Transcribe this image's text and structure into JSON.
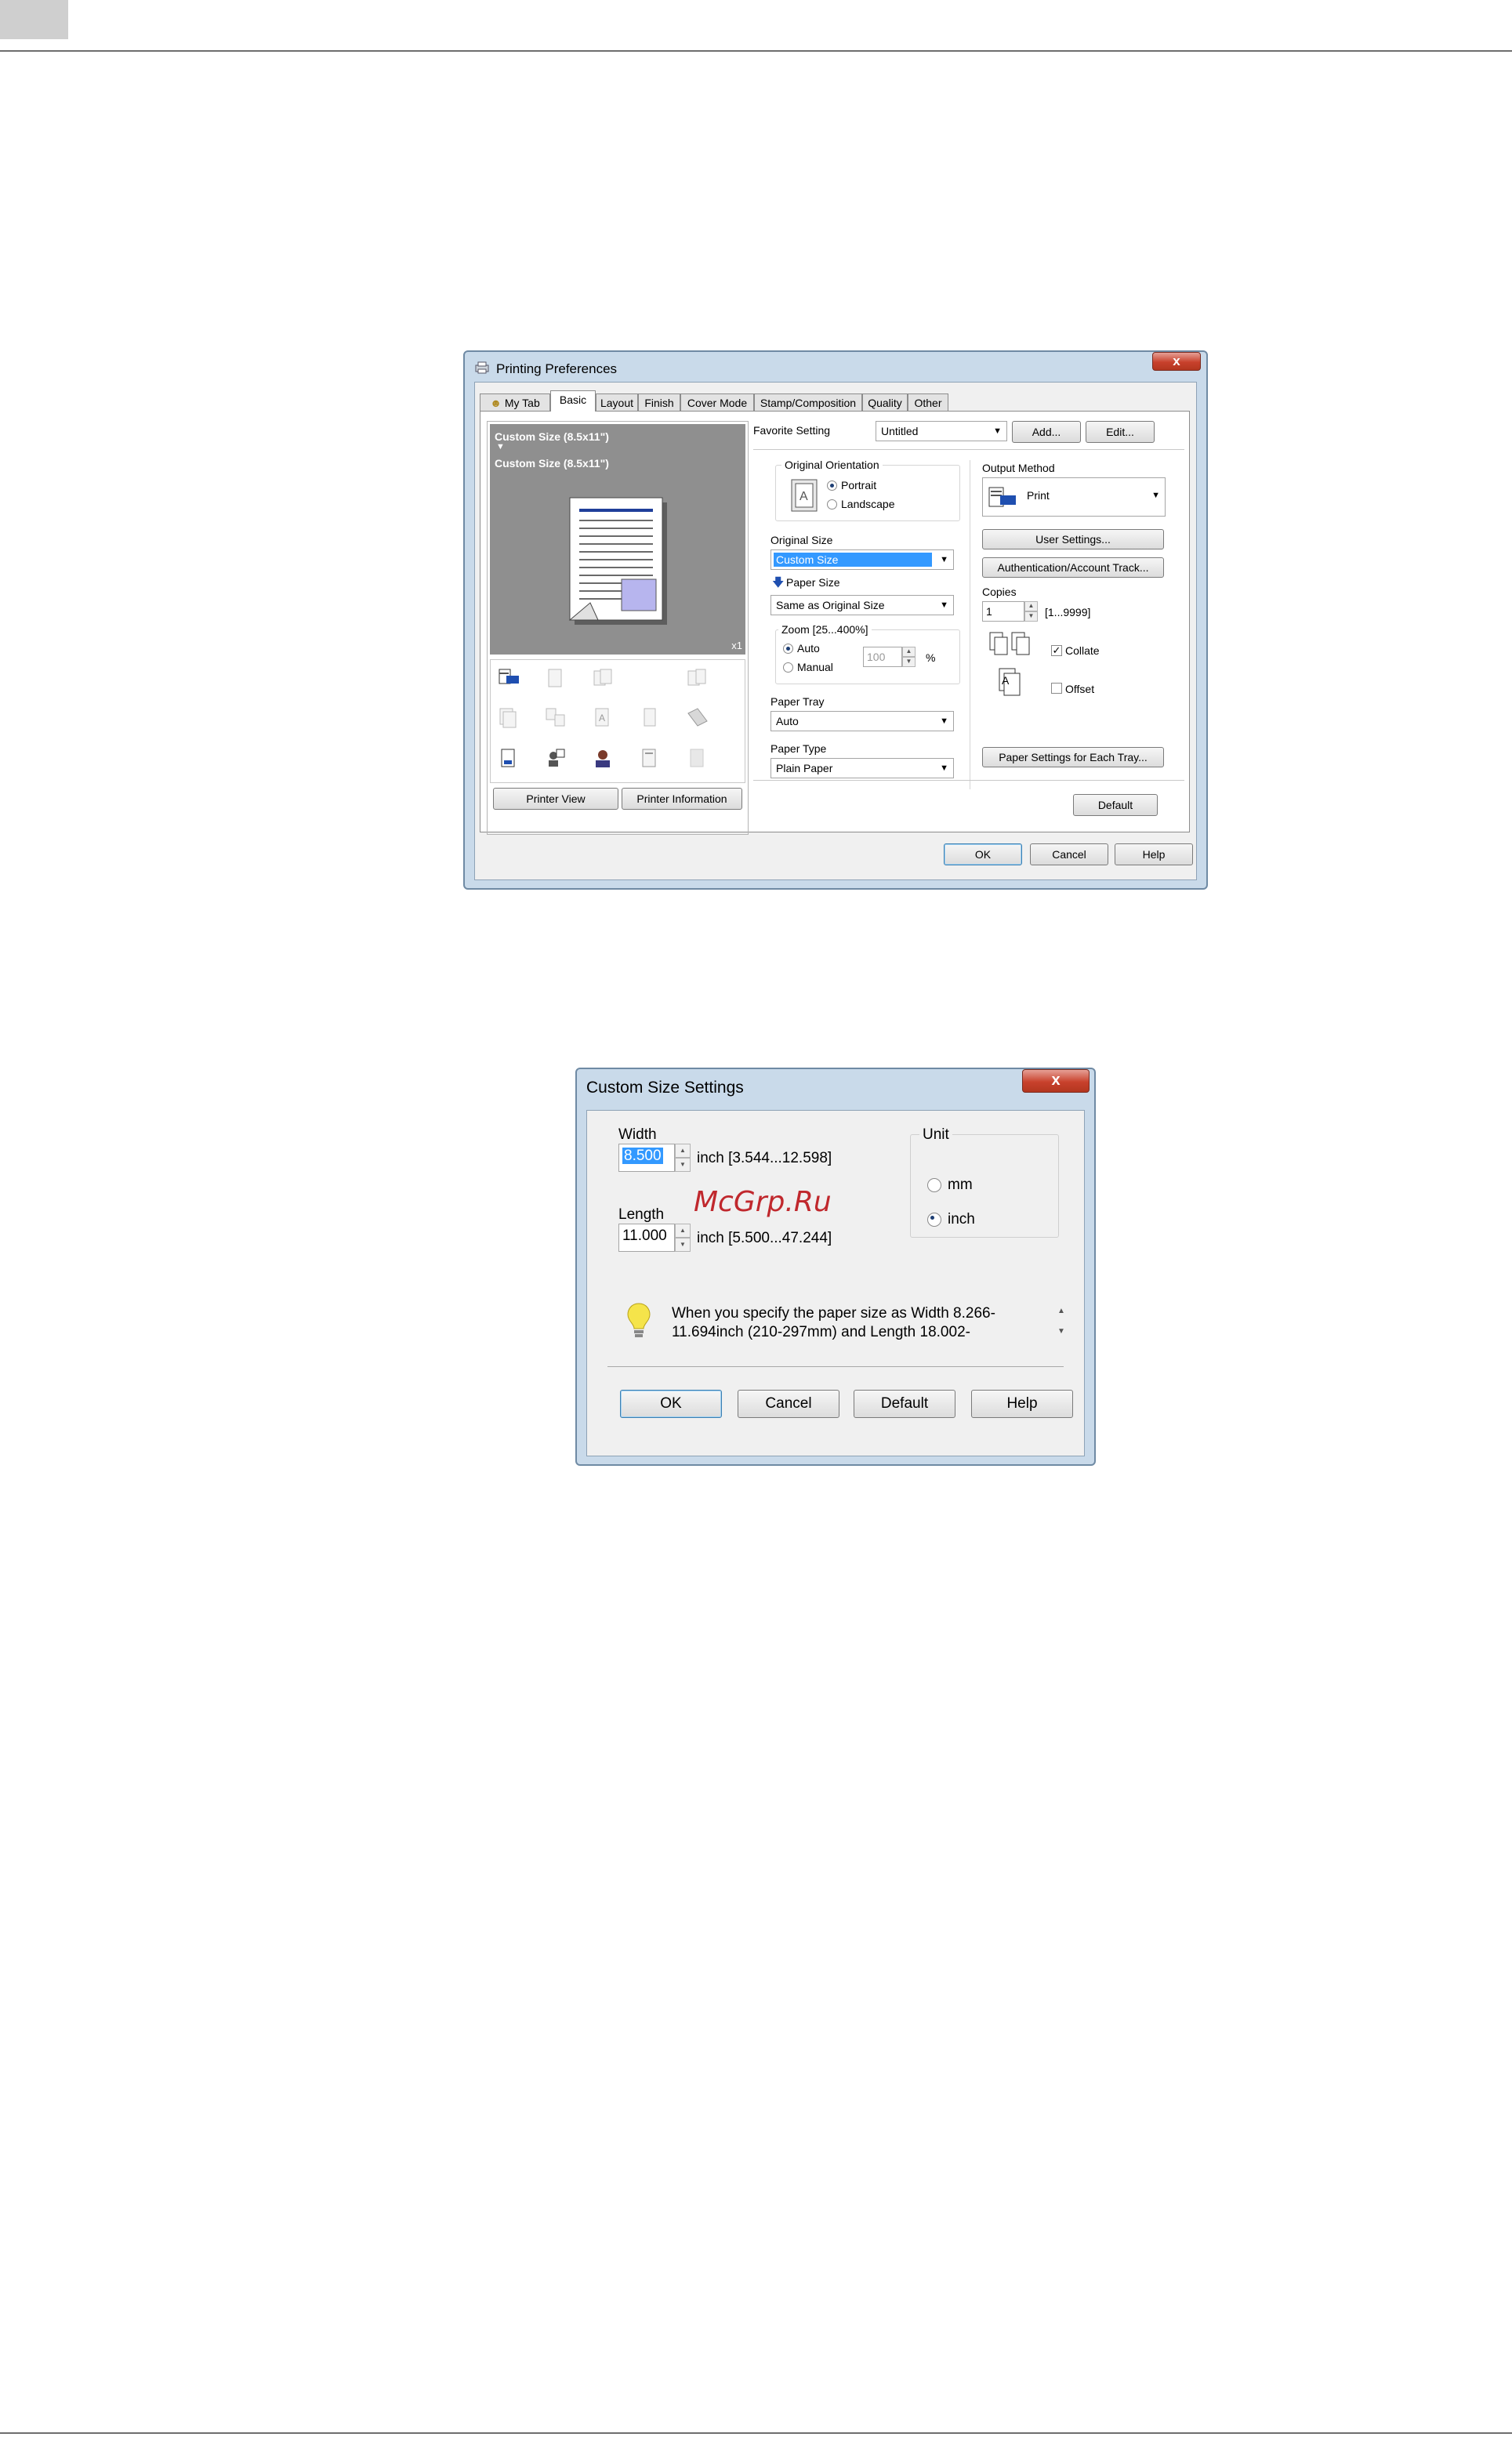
{
  "page": {
    "watermark": "McGrp.Ru"
  },
  "printing_preferences": {
    "title": "Printing Preferences",
    "close_label": "x",
    "tabs": [
      "My Tab",
      "Basic",
      "Layout",
      "Finish",
      "Cover Mode",
      "Stamp/Composition",
      "Quality",
      "Other"
    ],
    "active_tab": "Basic",
    "preview": {
      "line1": "Custom Size (8.5x11\")",
      "arrow": "▼",
      "line2": "Custom Size (8.5x11\")",
      "count": "x1"
    },
    "printer_view_button": "Printer View",
    "printer_information_button": "Printer Information",
    "favorite_setting_label": "Favorite Setting",
    "favorite_setting_value": "Untitled",
    "add_button": "Add...",
    "edit_button": "Edit...",
    "original_orientation_label": "Original Orientation",
    "portrait_label": "Portrait",
    "landscape_label": "Landscape",
    "original_size_label": "Original Size",
    "original_size_value": "Custom Size",
    "paper_size_label": "Paper Size",
    "paper_size_value": "Same as Original Size",
    "zoom_label": "Zoom [25...400%]",
    "zoom_auto_label": "Auto",
    "zoom_manual_label": "Manual",
    "zoom_value": "100",
    "zoom_unit": "%",
    "paper_tray_label": "Paper Tray",
    "paper_tray_value": "Auto",
    "paper_type_label": "Paper Type",
    "paper_type_value": "Plain Paper",
    "output_method_label": "Output Method",
    "output_method_value": "Print",
    "user_settings_button": "User Settings...",
    "authentication_button": "Authentication/Account Track...",
    "copies_label": "Copies",
    "copies_value": "1",
    "copies_range": "[1...9999]",
    "collate_label": "Collate",
    "offset_label": "Offset",
    "paper_settings_button": "Paper Settings for Each Tray...",
    "default_button": "Default",
    "ok_button": "OK",
    "cancel_button": "Cancel",
    "help_button": "Help"
  },
  "custom_size": {
    "title": "Custom Size Settings",
    "close_label": "x",
    "width_label": "Width",
    "width_value": "8.500",
    "width_range": "inch [3.544...12.598]",
    "length_label": "Length",
    "length_value": "11.000",
    "length_range": "inch [5.500...47.244]",
    "unit_label": "Unit",
    "unit_mm": "mm",
    "unit_inch": "inch",
    "unit_selected": "inch",
    "hint_line1": "When you specify the paper size as Width 8.266-",
    "hint_line2": "11.694inch (210-297mm) and Length 18.002-",
    "ok_button": "OK",
    "cancel_button": "Cancel",
    "default_button": "Default",
    "help_button": "Help"
  },
  "colors": {
    "selection": "#3399ff",
    "preview_bg": "#8f8f8f",
    "close_red": "#c8412c",
    "watermark_red": "#c0282d"
  }
}
